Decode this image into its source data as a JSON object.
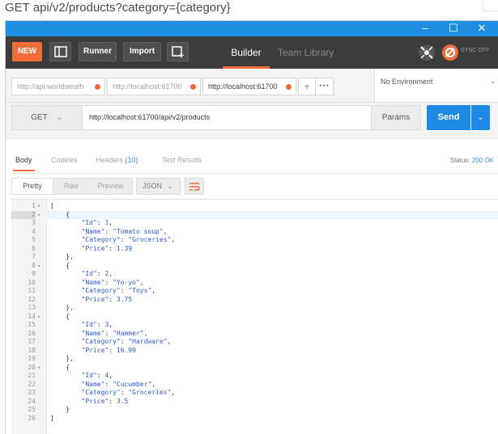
{
  "page_heading": "GET api/v2/products?category={category}",
  "window_controls": {
    "minimize": "–",
    "maximize": "☐",
    "close": "✕"
  },
  "toolbar": {
    "new_label": "NEW",
    "runner_label": "Runner",
    "import_label": "Import",
    "builder_label": "Builder",
    "team_library_label": "Team Library",
    "sync_label": "SYNC OFF",
    "accent": "#f26b3a"
  },
  "request_tabs": [
    {
      "label": "http://api.worldweath",
      "active": false
    },
    {
      "label": "http://localhost:61700",
      "active": false
    },
    {
      "label": "http://localhost:61700",
      "active": true
    }
  ],
  "add_tab_label": "+",
  "more_tabs_label": "•••",
  "environment": {
    "selected": "No Environment"
  },
  "request": {
    "method": "GET",
    "url": "http://localhost:61700/api/v2/products",
    "params_label": "Params",
    "send_label": "Send",
    "send_color": "#1e88e5"
  },
  "response_tabs": {
    "body": "Body",
    "cookies": "Cookies",
    "headers": "Headers",
    "headers_count": "(10)",
    "test_results": "Test Results"
  },
  "status": {
    "label": "Status:",
    "value": "200 OK"
  },
  "view_modes": {
    "pretty": "Pretty",
    "raw": "Raw",
    "preview": "Preview",
    "format": "JSON"
  },
  "code_lines": [
    {
      "n": "1",
      "fold": true,
      "text": "["
    },
    {
      "n": "2",
      "fold": true,
      "text": "    {",
      "highlight": true
    },
    {
      "n": "3",
      "text": "        \"Id\": 1,"
    },
    {
      "n": "4",
      "text": "        \"Name\": \"Tomato soup\","
    },
    {
      "n": "5",
      "text": "        \"Category\": \"Groceries\","
    },
    {
      "n": "6",
      "text": "        \"Price\": 1.39"
    },
    {
      "n": "7",
      "text": "    },"
    },
    {
      "n": "8",
      "fold": true,
      "text": "    {"
    },
    {
      "n": "9",
      "text": "        \"Id\": 2,"
    },
    {
      "n": "10",
      "text": "        \"Name\": \"Yo-yo\","
    },
    {
      "n": "11",
      "text": "        \"Category\": \"Toys\","
    },
    {
      "n": "12",
      "text": "        \"Price\": 3.75"
    },
    {
      "n": "13",
      "text": "    },"
    },
    {
      "n": "14",
      "fold": true,
      "text": "    {"
    },
    {
      "n": "15",
      "text": "        \"Id\": 3,"
    },
    {
      "n": "16",
      "text": "        \"Name\": \"Hammer\","
    },
    {
      "n": "17",
      "text": "        \"Category\": \"Hardware\","
    },
    {
      "n": "18",
      "text": "        \"Price\": 16.99"
    },
    {
      "n": "19",
      "text": "    },"
    },
    {
      "n": "20",
      "fold": true,
      "text": "    {"
    },
    {
      "n": "21",
      "text": "        \"Id\": 4,"
    },
    {
      "n": "22",
      "text": "        \"Name\": \"Cucumber\","
    },
    {
      "n": "23",
      "text": "        \"Category\": \"Groceries\","
    },
    {
      "n": "24",
      "text": "        \"Price\": 3.5"
    },
    {
      "n": "25",
      "text": "    }"
    },
    {
      "n": "26",
      "text": "]"
    }
  ]
}
